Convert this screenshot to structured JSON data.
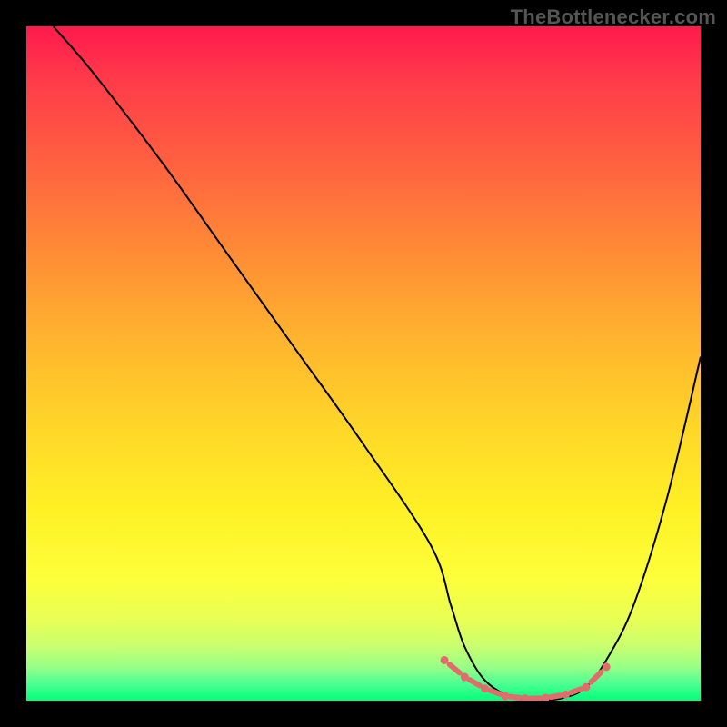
{
  "attribution": "TheBottlenecker.com",
  "chart_data": {
    "type": "line",
    "title": "",
    "xlabel": "",
    "ylabel": "",
    "xlim": [
      0,
      100
    ],
    "ylim": [
      0,
      100
    ],
    "series": [
      {
        "name": "bottleneck-curve",
        "color": "#000000",
        "x": [
          4,
          10,
          20,
          30,
          40,
          50,
          60,
          63,
          65,
          68,
          72,
          76,
          80,
          83,
          86,
          90,
          95,
          100
        ],
        "y": [
          100,
          93,
          80,
          66,
          52,
          38,
          23,
          14,
          8,
          3,
          0.5,
          0,
          0.5,
          2,
          6,
          14,
          30,
          51
        ]
      },
      {
        "name": "optimal-marker",
        "color": "#e26b6b",
        "style": "dotted-thick",
        "x": [
          62,
          65,
          68,
          71,
          74,
          77,
          80,
          83,
          86
        ],
        "y": [
          6,
          3.5,
          1.8,
          0.7,
          0.3,
          0.4,
          0.9,
          2,
          5
        ]
      }
    ],
    "gradient_stops": [
      {
        "pos": 0,
        "color": "#ff1a4d"
      },
      {
        "pos": 50,
        "color": "#ffc828"
      },
      {
        "pos": 85,
        "color": "#fbff3a"
      },
      {
        "pos": 100,
        "color": "#00ff7b"
      }
    ]
  }
}
